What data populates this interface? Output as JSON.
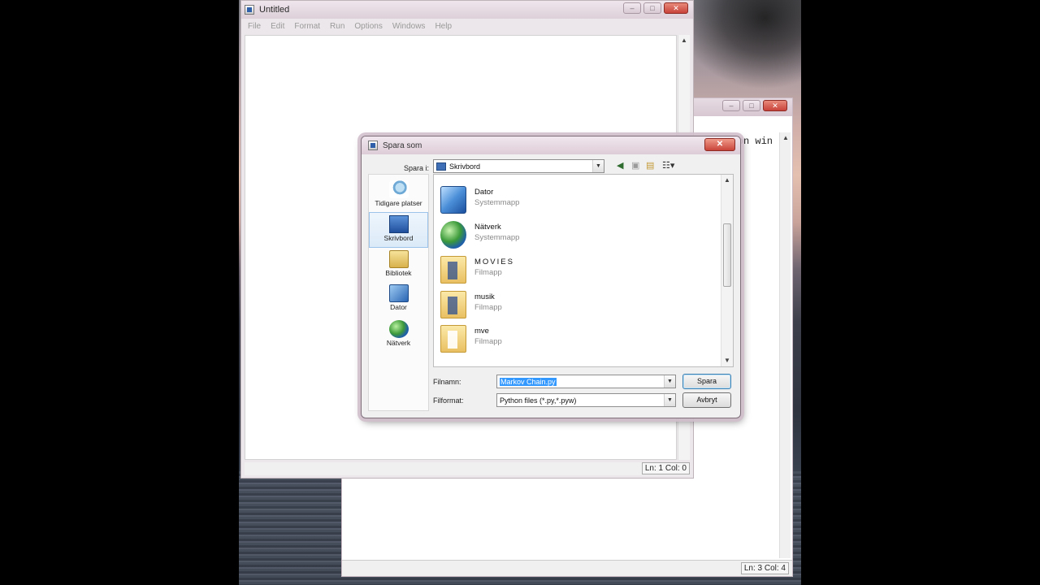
{
  "editor": {
    "title": "Untitled",
    "menu": [
      "File",
      "Edit",
      "Format",
      "Run",
      "Options",
      "Windows",
      "Help"
    ],
    "status": "Ln: 1 Col: 0"
  },
  "shell": {
    "partial_text": "on win",
    "status": "Ln: 3 Col: 4"
  },
  "dialog": {
    "title": "Spara som",
    "close": "✕",
    "save_in_label": "Spara i:",
    "save_in_value": "Skrivbord",
    "places": [
      "Tidigare platser",
      "Skrivbord",
      "Bibliotek",
      "Dator",
      "Nätverk"
    ],
    "files": [
      {
        "name": "Dator",
        "type": "Systemmapp"
      },
      {
        "name": "Nätverk",
        "type": "Systemmapp"
      },
      {
        "name": "MOVIES",
        "type": "Filmapp"
      },
      {
        "name": "musik",
        "type": "Filmapp"
      },
      {
        "name": "mve",
        "type": "Filmapp"
      }
    ],
    "filename_label": "Filnamn:",
    "filename_value": "Markov Chain.py",
    "filetype_label": "Filformat:",
    "filetype_value": "Python files (*.py,*.pyw)",
    "save_button": "Spara",
    "cancel_button": "Avbryt"
  },
  "colors": {
    "selection": "#3399ff",
    "close_red": "#c9443a",
    "title_bar": "#ddccd7"
  }
}
